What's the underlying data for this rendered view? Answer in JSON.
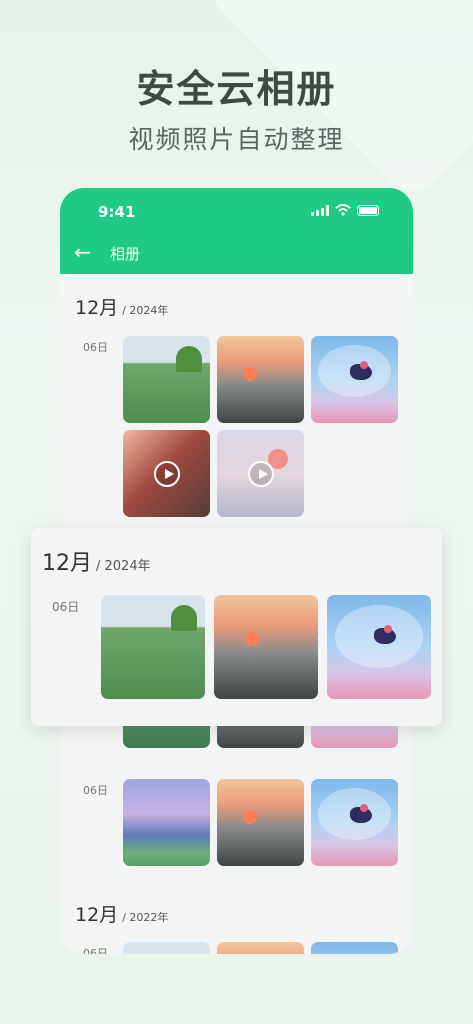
{
  "promo": {
    "headline": "安全云相册",
    "subline": "视频照片自动整理"
  },
  "status_bar": {
    "time": "9:41"
  },
  "nav": {
    "back_icon": "←",
    "title": "相册"
  },
  "sections": [
    {
      "month": "12月",
      "year": "/ 2024年",
      "day": "06日"
    },
    {
      "day": "06日"
    },
    {
      "month": "12月",
      "year": "/ 2022年",
      "day": "06日"
    }
  ],
  "popup": {
    "month": "12月",
    "year": "/ 2024年",
    "day": "06日"
  },
  "colors": {
    "accent": "#1fcb84",
    "background": "#e8f3eb"
  }
}
